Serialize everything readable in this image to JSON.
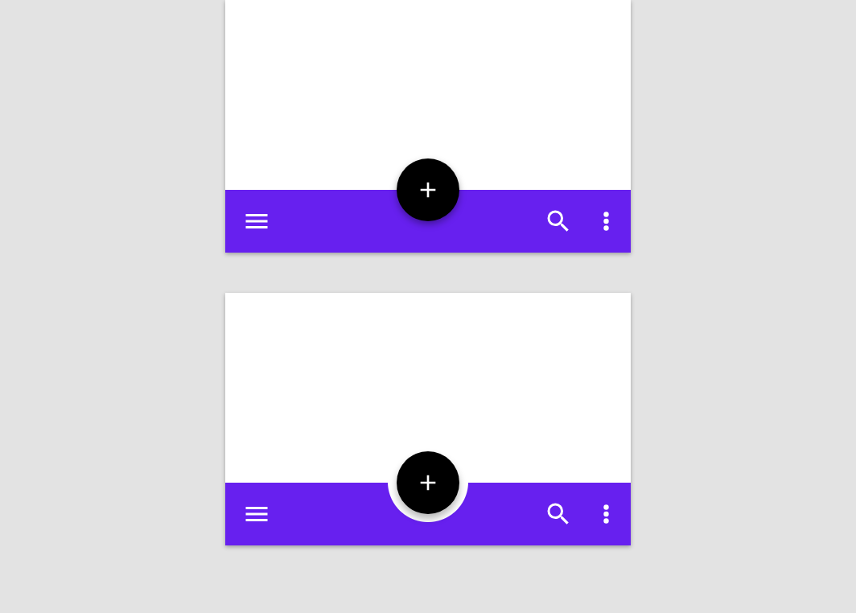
{
  "demos": [
    {
      "kind": "overlap"
    },
    {
      "kind": "cradled"
    }
  ]
}
